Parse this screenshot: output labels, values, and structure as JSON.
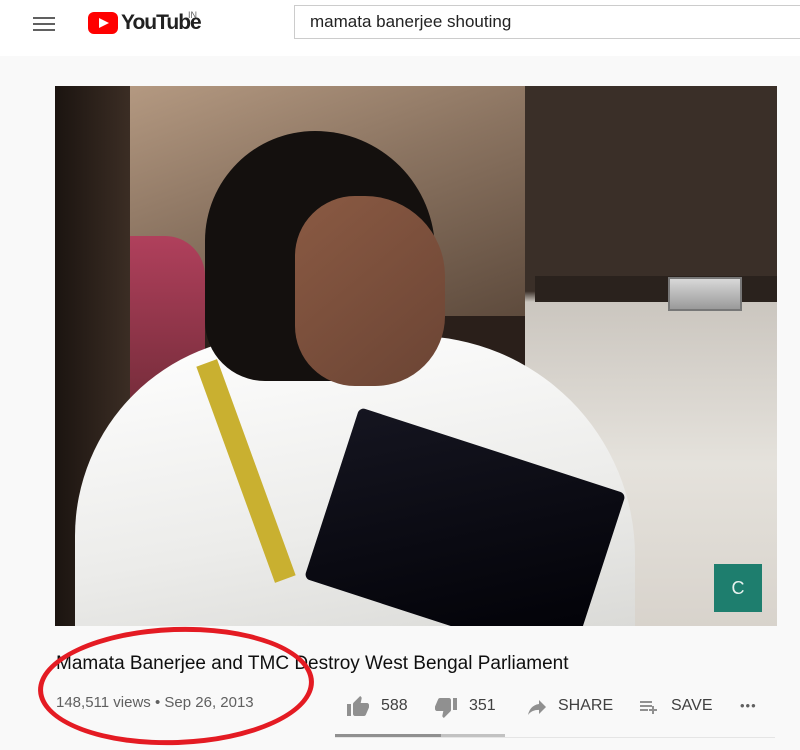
{
  "header": {
    "logo_text": "YouTube",
    "region": "IN",
    "search_value": "mamata banerjee shouting"
  },
  "player": {
    "channel_badge": "C"
  },
  "video": {
    "title": "Mamata Banerjee and TMC Destroy West Bengal Parliament",
    "views": "148,511 views",
    "separator": "•",
    "date": "Sep 26, 2013",
    "likes": "588",
    "dislikes": "351",
    "share_label": "SHARE",
    "save_label": "SAVE",
    "more_label": "•••",
    "like_ratio": 0.626
  },
  "annotation": {
    "circle_color": "#e41b23"
  },
  "colors": {
    "brand": "#ff0000",
    "badge": "#1e7e6e"
  }
}
